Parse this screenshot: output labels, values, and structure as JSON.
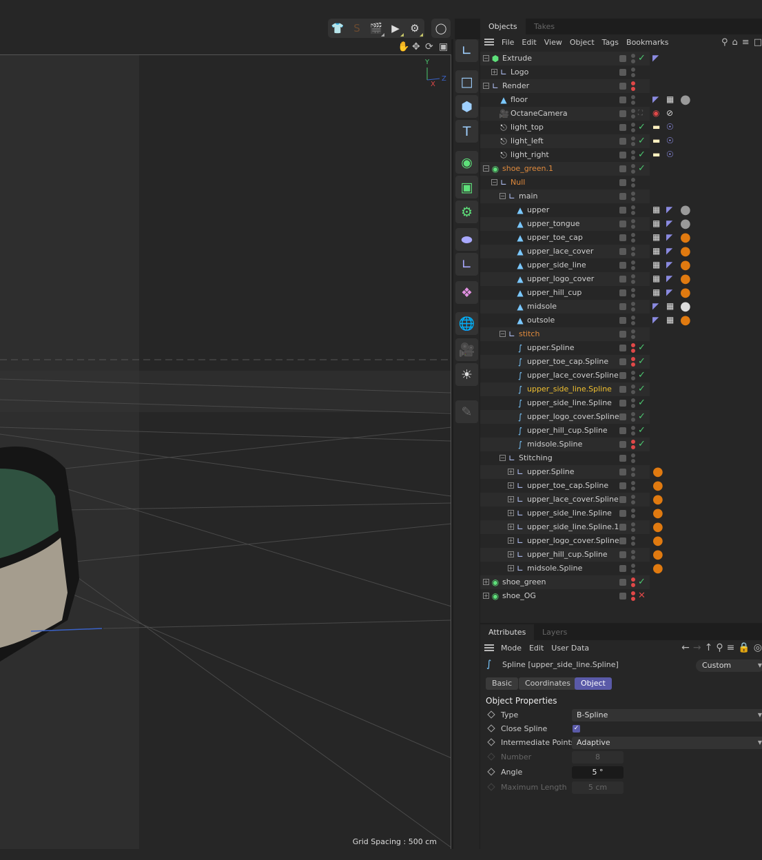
{
  "viewport": {
    "grid_spacing": "Grid Spacing : 500 cm",
    "axis_labels": {
      "y": "Y",
      "z": "Z",
      "x": "X"
    },
    "toolbar_icons": [
      "shirt-icon",
      "spline-pen-icon",
      "render-view-icon",
      "render-picture-viewer-icon",
      "render-settings-icon",
      "octane-live-viewer-icon"
    ],
    "nav_icons": [
      "pan-hand-icon",
      "move-icon",
      "rotate-icon",
      "maximize-icon"
    ]
  },
  "left_tools": [
    "null-object-icon",
    "cube-icon",
    "square-icon",
    "text-icon",
    "subdivision-icon",
    "cloner-icon",
    "effector-icon",
    "deformer-icon",
    "coordinate-icon",
    "mograph-icon",
    "environment-icon",
    "camera-icon",
    "light-icon",
    "tag-icon"
  ],
  "object_manager": {
    "tabs": [
      "Objects",
      "Takes"
    ],
    "menu": [
      "File",
      "Edit",
      "View",
      "Object",
      "Tags",
      "Bookmarks"
    ],
    "rows": [
      {
        "name": "Extrude",
        "level": 0,
        "exp": "-",
        "icon": "extrude",
        "color": "normal",
        "dots": "gray",
        "check": "check",
        "tags": [
          "phong"
        ]
      },
      {
        "name": "Logo",
        "level": 1,
        "exp": "+",
        "icon": "null",
        "color": "normal",
        "dots": "gray",
        "check": "",
        "tags": []
      },
      {
        "name": "Render",
        "level": 0,
        "exp": "-",
        "icon": "null",
        "color": "normal",
        "dots": "red",
        "check": "",
        "tags": []
      },
      {
        "name": "floor",
        "level": 1,
        "exp": "",
        "icon": "poly",
        "color": "normal",
        "dots": "gray",
        "check": "",
        "tags": [
          "phong",
          "checker",
          "mat-gray"
        ]
      },
      {
        "name": "OctaneCamera",
        "level": 1,
        "exp": "",
        "icon": "camera",
        "color": "normal",
        "dots": "gray",
        "check": "frame",
        "tags": [
          "camtag",
          "no"
        ]
      },
      {
        "name": "light_top",
        "level": 1,
        "exp": "",
        "icon": "light",
        "color": "normal",
        "dots": "gray",
        "check": "check",
        "tags": [
          "lighttag",
          "target"
        ]
      },
      {
        "name": "light_left",
        "level": 1,
        "exp": "",
        "icon": "light",
        "color": "normal",
        "dots": "gray",
        "check": "check",
        "tags": [
          "lighttag",
          "target"
        ]
      },
      {
        "name": "light_right",
        "level": 1,
        "exp": "",
        "icon": "light",
        "color": "normal",
        "dots": "gray",
        "check": "check",
        "tags": [
          "lighttag",
          "target"
        ]
      },
      {
        "name": "shoe_green.1",
        "level": 0,
        "exp": "-",
        "icon": "symmetry",
        "color": "orange",
        "dots": "gray",
        "check": "check",
        "tags": []
      },
      {
        "name": "Null",
        "level": 1,
        "exp": "-",
        "icon": "null",
        "color": "orange",
        "dots": "gray",
        "check": "",
        "tags": []
      },
      {
        "name": "main",
        "level": 2,
        "exp": "-",
        "icon": "null",
        "color": "normal",
        "dots": "gray",
        "check": "",
        "tags": []
      },
      {
        "name": "upper",
        "level": 3,
        "exp": "",
        "icon": "poly",
        "color": "normal",
        "dots": "gray",
        "check": "",
        "tags": [
          "checker",
          "phong",
          "mat-gray"
        ]
      },
      {
        "name": "upper_tongue",
        "level": 3,
        "exp": "",
        "icon": "poly",
        "color": "normal",
        "dots": "gray",
        "check": "",
        "tags": [
          "checker",
          "phong",
          "mat-gray"
        ]
      },
      {
        "name": "upper_toe_cap",
        "level": 3,
        "exp": "",
        "icon": "poly",
        "color": "normal",
        "dots": "gray",
        "check": "",
        "tags": [
          "checker",
          "phong",
          "mat-orange"
        ]
      },
      {
        "name": "upper_lace_cover",
        "level": 3,
        "exp": "",
        "icon": "poly",
        "color": "normal",
        "dots": "gray",
        "check": "",
        "tags": [
          "checker",
          "phong",
          "mat-orange"
        ]
      },
      {
        "name": "upper_side_line",
        "level": 3,
        "exp": "",
        "icon": "poly",
        "color": "normal",
        "dots": "gray",
        "check": "",
        "tags": [
          "checker",
          "phong",
          "mat-orange"
        ]
      },
      {
        "name": "upper_logo_cover",
        "level": 3,
        "exp": "",
        "icon": "poly",
        "color": "normal",
        "dots": "gray",
        "check": "",
        "tags": [
          "checker",
          "phong",
          "mat-orange"
        ]
      },
      {
        "name": "upper_hill_cup",
        "level": 3,
        "exp": "",
        "icon": "poly",
        "color": "normal",
        "dots": "gray",
        "check": "",
        "tags": [
          "checker",
          "phong",
          "mat-orange"
        ]
      },
      {
        "name": "midsole",
        "level": 3,
        "exp": "",
        "icon": "poly",
        "color": "normal",
        "dots": "gray",
        "check": "",
        "tags": [
          "phong",
          "checker",
          "mat-white"
        ]
      },
      {
        "name": "outsole",
        "level": 3,
        "exp": "",
        "icon": "poly",
        "color": "normal",
        "dots": "gray",
        "check": "",
        "tags": [
          "phong",
          "checker",
          "mat-orange"
        ]
      },
      {
        "name": "stitch",
        "level": 2,
        "exp": "-",
        "icon": "null",
        "color": "orange",
        "dots": "gray",
        "check": "",
        "tags": []
      },
      {
        "name": "upper.Spline",
        "level": 3,
        "exp": "",
        "icon": "spline",
        "color": "normal",
        "dots": "red",
        "check": "check",
        "tags": []
      },
      {
        "name": "upper_toe_cap.Spline",
        "level": 3,
        "exp": "",
        "icon": "spline",
        "color": "normal",
        "dots": "red",
        "check": "check",
        "tags": []
      },
      {
        "name": "upper_lace_cover.Spline",
        "level": 3,
        "exp": "",
        "icon": "spline",
        "color": "normal",
        "dots": "gray",
        "check": "check",
        "tags": []
      },
      {
        "name": "upper_side_line.Spline",
        "level": 3,
        "exp": "",
        "icon": "spline",
        "color": "selected",
        "dots": "gray",
        "check": "check",
        "tags": []
      },
      {
        "name": "upper_side_line.Spline",
        "level": 3,
        "exp": "",
        "icon": "spline",
        "color": "normal",
        "dots": "gray",
        "check": "check",
        "tags": []
      },
      {
        "name": "upper_logo_cover.Spline",
        "level": 3,
        "exp": "",
        "icon": "spline",
        "color": "normal",
        "dots": "gray",
        "check": "check",
        "tags": []
      },
      {
        "name": "upper_hill_cup.Spline",
        "level": 3,
        "exp": "",
        "icon": "spline",
        "color": "normal",
        "dots": "gray",
        "check": "check",
        "tags": []
      },
      {
        "name": "midsole.Spline",
        "level": 3,
        "exp": "",
        "icon": "spline",
        "color": "normal",
        "dots": "red",
        "check": "check",
        "tags": []
      },
      {
        "name": "Stitching",
        "level": 2,
        "exp": "-",
        "icon": "null",
        "color": "normal",
        "dots": "gray",
        "check": "",
        "tags": []
      },
      {
        "name": "upper.Spline",
        "level": 3,
        "exp": "+",
        "icon": "null",
        "color": "normal",
        "dots": "gray",
        "check": "",
        "tags": [
          "mat-orange"
        ]
      },
      {
        "name": "upper_toe_cap.Spline",
        "level": 3,
        "exp": "+",
        "icon": "null",
        "color": "normal",
        "dots": "gray",
        "check": "",
        "tags": [
          "mat-orange"
        ]
      },
      {
        "name": "upper_lace_cover.Spline",
        "level": 3,
        "exp": "+",
        "icon": "null",
        "color": "normal",
        "dots": "gray",
        "check": "",
        "tags": [
          "mat-orange"
        ]
      },
      {
        "name": "upper_side_line.Spline",
        "level": 3,
        "exp": "+",
        "icon": "null",
        "color": "normal",
        "dots": "gray",
        "check": "",
        "tags": [
          "mat-orange"
        ]
      },
      {
        "name": "upper_side_line.Spline.1",
        "level": 3,
        "exp": "+",
        "icon": "null",
        "color": "normal",
        "dots": "gray",
        "check": "",
        "tags": [
          "mat-orange"
        ]
      },
      {
        "name": "upper_logo_cover.Spline",
        "level": 3,
        "exp": "+",
        "icon": "null",
        "color": "normal",
        "dots": "gray",
        "check": "",
        "tags": [
          "mat-orange"
        ]
      },
      {
        "name": "upper_hill_cup.Spline",
        "level": 3,
        "exp": "+",
        "icon": "null",
        "color": "normal",
        "dots": "gray",
        "check": "",
        "tags": [
          "mat-orange"
        ]
      },
      {
        "name": "midsole.Spline",
        "level": 3,
        "exp": "+",
        "icon": "null",
        "color": "normal",
        "dots": "gray",
        "check": "",
        "tags": [
          "mat-orange"
        ]
      },
      {
        "name": "shoe_green",
        "level": 0,
        "exp": "+",
        "icon": "symmetry",
        "color": "normal",
        "dots": "red",
        "check": "check",
        "tags": []
      },
      {
        "name": "shoe_OG",
        "level": 0,
        "exp": "+",
        "icon": "symmetry",
        "color": "normal",
        "dots": "red",
        "check": "x",
        "tags": []
      }
    ]
  },
  "attributes": {
    "tabs": [
      "Attributes",
      "Layers"
    ],
    "menu": [
      "Mode",
      "Edit",
      "User Data"
    ],
    "object_title": "Spline [upper_side_line.Spline]",
    "preset": "Custom",
    "sub_tabs": [
      "Basic",
      "Coordinates",
      "Object"
    ],
    "active_sub_tab": "Object",
    "section_title": "Object Properties",
    "props": {
      "type_label": "Type",
      "type_value": "B-Spline",
      "close_label": "Close Spline",
      "close_checked": true,
      "interp_label": "Intermediate Points",
      "interp_value": "Adaptive",
      "number_label": "Number",
      "number_value": "8",
      "angle_label": "Angle",
      "angle_value": "5 °",
      "maxlen_label": "Maximum Length",
      "maxlen_value": "5 cm"
    }
  },
  "colors": {
    "accent": "#5a5aa8",
    "orange_text": "#e08a3c",
    "selected_text": "#f0c030",
    "check": "#4cc870",
    "red": "#e04848"
  }
}
